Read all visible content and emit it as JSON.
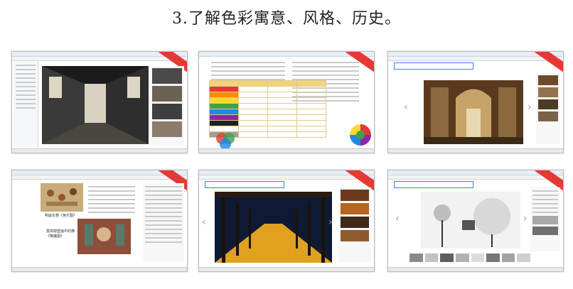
{
  "heading": "3.了解色彩寓意、风格、历史。",
  "screenshots": [
    {
      "label": "interior design image viewer",
      "ribbon": ""
    },
    {
      "label": "color meaning document",
      "ribbon": ""
    },
    {
      "label": "baidu image search - church interior",
      "ribbon": ""
    },
    {
      "label": "article with ancient paintings",
      "ribbon": "",
      "captions": [
        "明画长卷《宫乐图》",
        "莫高窟壁画中的佛\n《降魔图》"
      ]
    },
    {
      "label": "baidu image search - corridor",
      "ribbon": ""
    },
    {
      "label": "baidu image search - photo studio",
      "ribbon": ""
    }
  ]
}
